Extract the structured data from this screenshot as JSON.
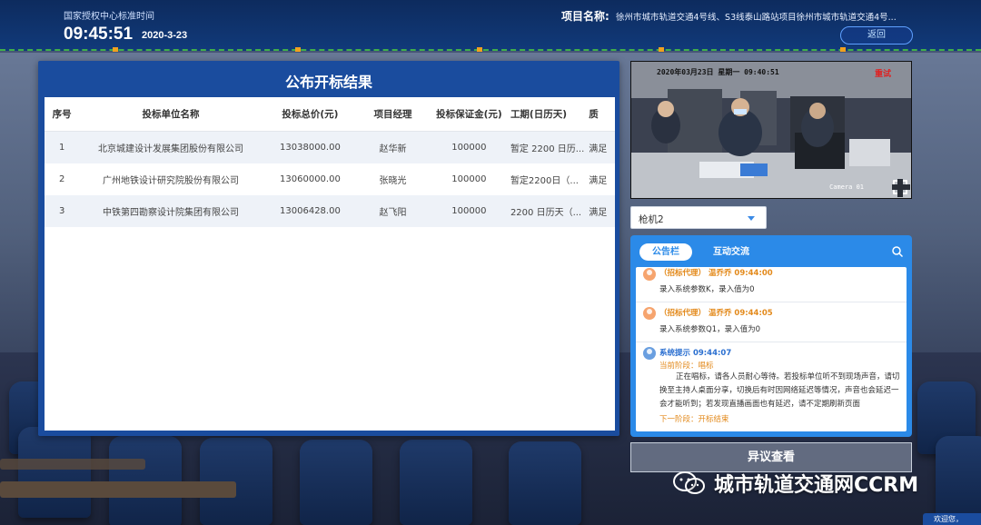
{
  "header": {
    "time_label": "国家授权中心标准时间",
    "time": "09:45:51",
    "date": "2020-3-23",
    "project_label": "项目名称:",
    "project_value": "徐州市城市轨道交通4号线、S3线泰山路站项目徐州市城市轨道交通4号...",
    "back_label": "返回"
  },
  "main": {
    "title": "公布开标结果",
    "columns": [
      "序号",
      "投标单位名称",
      "投标总价(元)",
      "项目经理",
      "投标保证金(元)",
      "工期(日历天)",
      "质"
    ],
    "rows": [
      [
        "1",
        "北京城建设计发展集团股份有限公司",
        "13038000.00",
        "赵华新",
        "100000",
        "暂定 2200 日历...",
        "满足"
      ],
      [
        "2",
        "广州地铁设计研究院股份有限公司",
        "13060000.00",
        "张晓光",
        "100000",
        "暂定2200日（...",
        "满足"
      ],
      [
        "3",
        "中铁第四勘察设计院集团有限公司",
        "13006428.00",
        "赵飞阳",
        "100000",
        "2200 日历天（...",
        "满足"
      ]
    ]
  },
  "video": {
    "timestamp": "2020年03月23日  星期一  09:40:51",
    "status": "重试",
    "camera": "Camera 01"
  },
  "camera_select": {
    "value": "枪机2"
  },
  "chat": {
    "tab_active": "公告栏",
    "tab_inactive": "互动交流",
    "messages": [
      {
        "sender": "（招标代理）   温乔乔 09:44:00",
        "text": "录入系统参数K，录入值为0"
      },
      {
        "sender": "（招标代理）   温乔乔 09:44:05",
        "text": "录入系统参数Q1，录入值为0"
      }
    ],
    "system": {
      "sender": "系统提示  09:44:07",
      "stage": "当前阶段：唱标",
      "paragraph": "正在唱标，请各人员耐心等待。若投标单位听不到现场声音，请切换至主持人桌面分享，切换后有时因网络延迟等情况，声音也会延迟一会才能听到；若发现直播画面也有延迟，请不定期刷新页面",
      "next": "下一阶段：开标结束"
    }
  },
  "objection_button": "异议查看",
  "watermark": "城市轨道交通网CCRM",
  "welcome": "欢迎您，"
}
